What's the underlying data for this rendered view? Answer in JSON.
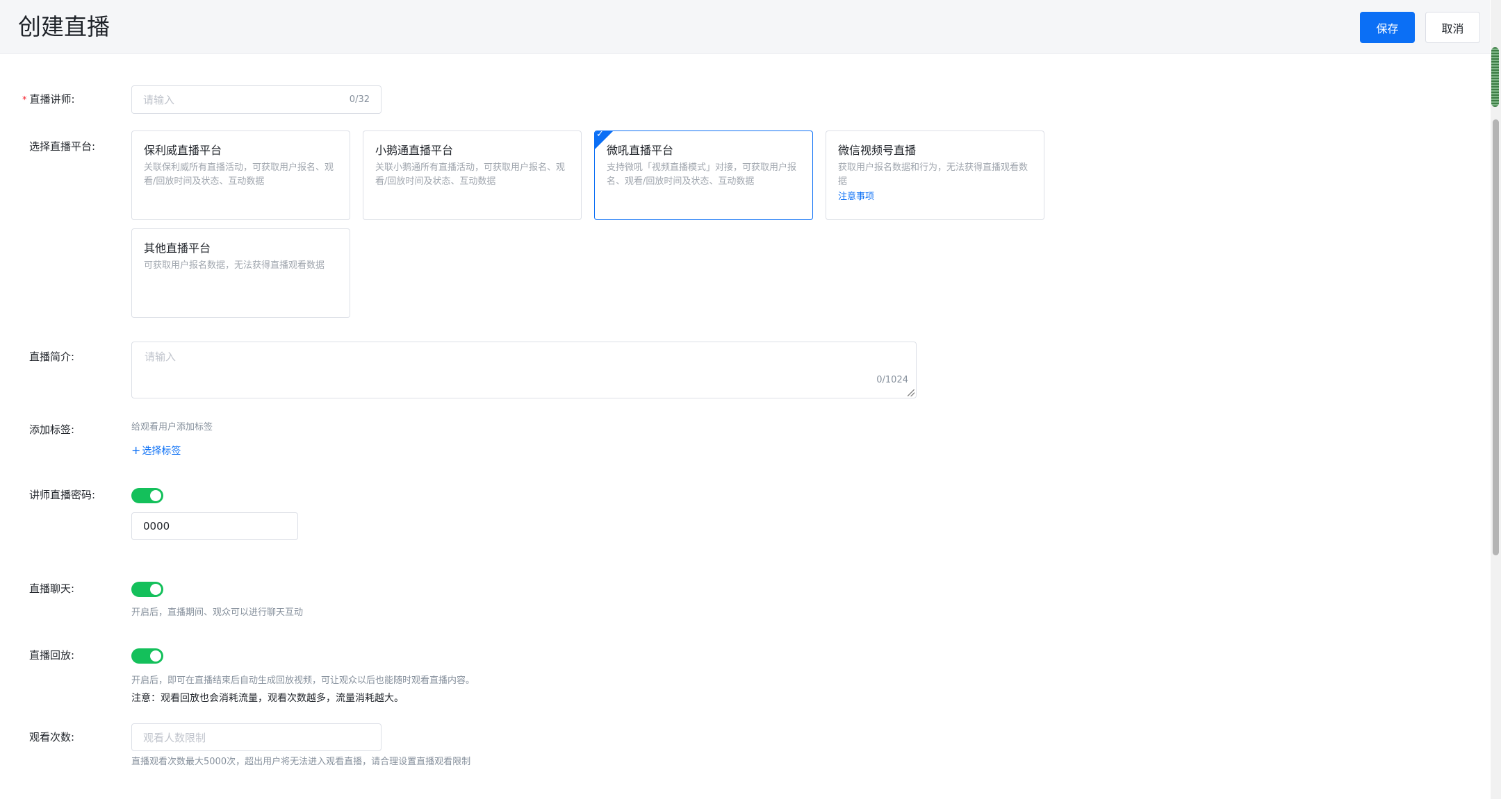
{
  "header": {
    "title": "创建直播",
    "save_label": "保存",
    "cancel_label": "取消"
  },
  "form": {
    "lecturer": {
      "label": "直播讲师:",
      "placeholder": "请输入",
      "count": "0/32"
    },
    "platform": {
      "label": "选择直播平台:",
      "cards": [
        {
          "title": "保利威直播平台",
          "desc": "关联保利威所有直播活动，可获取用户报名、观看/回放时间及状态、互动数据"
        },
        {
          "title": "小鹅通直播平台",
          "desc": "关联小鹅通所有直播活动，可获取用户报名、观看/回放时间及状态、互动数据"
        },
        {
          "title": "微吼直播平台",
          "desc": "支持微吼「视频直播模式」对接，可获取用户报名、观看/回放时间及状态、互动数据"
        },
        {
          "title": "微信视频号直播",
          "desc": "获取用户报名数据和行为，无法获得直播观看数据",
          "link": "注意事项"
        },
        {
          "title": "其他直播平台",
          "desc": "可获取用户报名数据，无法获得直播观看数据"
        }
      ],
      "selected_index": 2
    },
    "intro": {
      "label": "直播简介:",
      "placeholder": "请输入",
      "count": "0/1024"
    },
    "tags": {
      "label": "添加标签:",
      "help": "给观看用户添加标签",
      "action": "选择标签"
    },
    "password": {
      "label": "讲师直播密码:",
      "enabled": true,
      "value": "0000"
    },
    "chat": {
      "label": "直播聊天:",
      "enabled": true,
      "help": "开启后，直播期间、观众可以进行聊天互动"
    },
    "replay": {
      "label": "直播回放:",
      "enabled": true,
      "help": "开启后，即可在直播结束后自动生成回放视频，可让观众以后也能随时观看直播内容。",
      "note": "注意：观看回放也会消耗流量，观看次数越多，流量消耗越大。"
    },
    "views": {
      "label": "观看次数:",
      "placeholder": "观看人数限制",
      "help": "直播观看次数最大5000次，超出用户将无法进入观看直播，请合理设置直播观看限制"
    }
  },
  "colors": {
    "primary": "#0b6ff5",
    "switch_on": "#14c05b",
    "required": "#f5222d"
  }
}
